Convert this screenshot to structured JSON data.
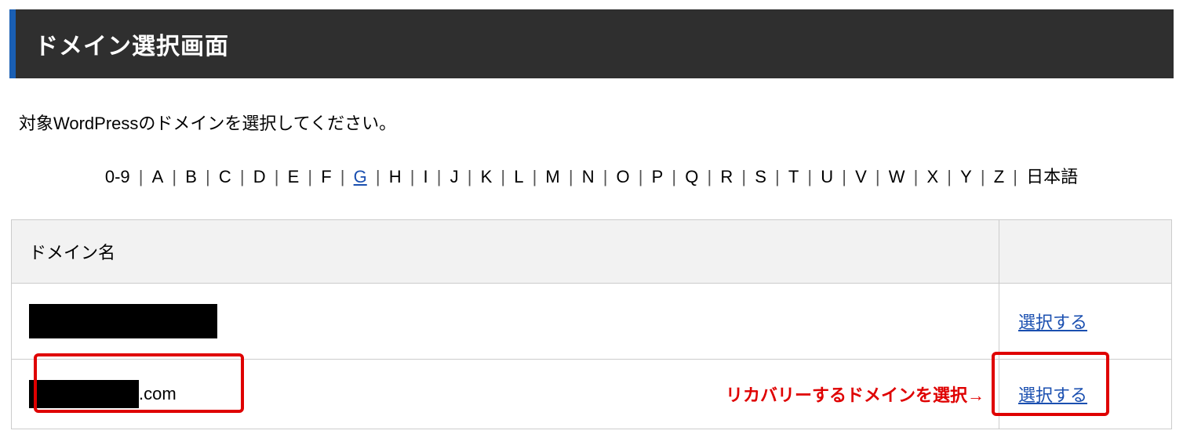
{
  "header": {
    "title": "ドメイン選択画面"
  },
  "instruction": "対象WordPressのドメインを選択してください。",
  "alpha_filter": {
    "items": [
      "0-9",
      "A",
      "B",
      "C",
      "D",
      "E",
      "F",
      "G",
      "H",
      "I",
      "J",
      "K",
      "L",
      "M",
      "N",
      "O",
      "P",
      "Q",
      "R",
      "S",
      "T",
      "U",
      "V",
      "W",
      "X",
      "Y",
      "Z",
      "日本語"
    ],
    "active": "G",
    "separator": "|"
  },
  "table": {
    "header": {
      "domain": "ドメイン名",
      "action": ""
    },
    "rows": [
      {
        "domain_suffix": "",
        "redacted": true,
        "select_label": "選択する"
      },
      {
        "domain_suffix": ".com",
        "redacted": true,
        "select_label": "選択する"
      }
    ]
  },
  "annotation": "リカバリーするドメインを選択→"
}
